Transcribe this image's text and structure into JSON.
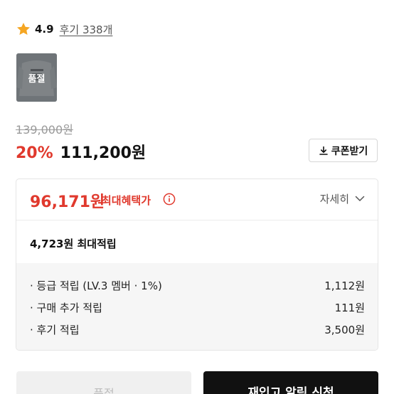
{
  "rating": {
    "score": "4.9",
    "review_link": "후기 338개",
    "star_color": "#f5a623",
    "icon": "star-icon"
  },
  "thumbnail": {
    "badge": "품절"
  },
  "price": {
    "original": "139,000원",
    "discount": "20%",
    "sale": "111,200원",
    "accent_color": "#e0392d"
  },
  "coupon": {
    "label": "쿠폰받기",
    "icon": "download-icon"
  },
  "benefit": {
    "max_price": "96,171원",
    "max_label": "최대혜택가",
    "info_icon": "info-icon",
    "detail_label": "자세히",
    "detail_icon": "chevron-down-icon",
    "points_amount": "4,723원",
    "points_label": "최대적립",
    "items": [
      {
        "label": "· 등급 적립 (LV.3 멤버 · 1%)",
        "value": "1,112원"
      },
      {
        "label": "· 구매 추가 적립",
        "value": "111원"
      },
      {
        "label": "· 후기 적립",
        "value": "3,500원"
      }
    ]
  },
  "actions": {
    "soldout_label": "품절",
    "restock_label": "재입고 알림 신청"
  }
}
